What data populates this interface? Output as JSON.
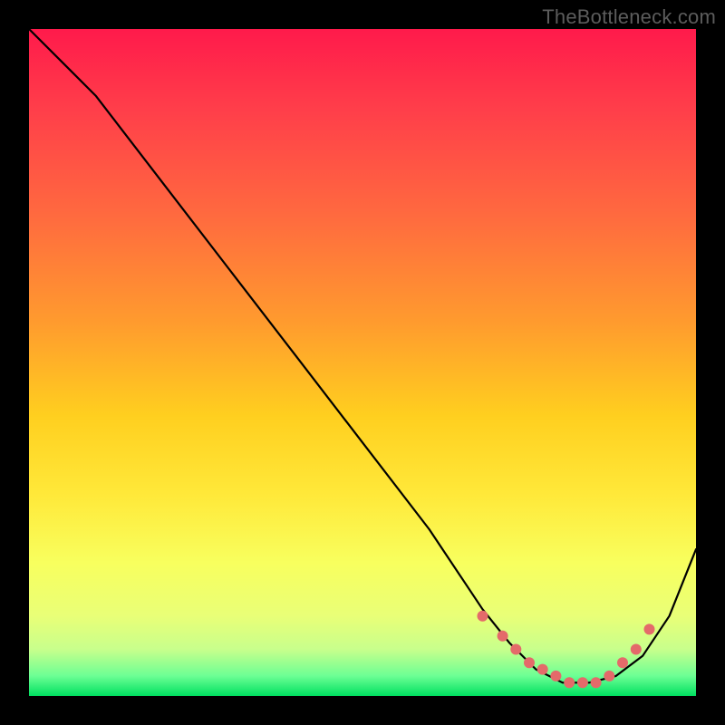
{
  "watermark": "TheBottleneck.com",
  "chart_data": {
    "type": "line",
    "title": "",
    "xlabel": "",
    "ylabel": "",
    "xlim": [
      0,
      100
    ],
    "ylim": [
      0,
      100
    ],
    "grid": false,
    "legend": false,
    "series": [
      {
        "name": "curve",
        "color": "#000000",
        "x": [
          0,
          6,
          10,
          20,
          30,
          40,
          50,
          60,
          68,
          72,
          76,
          80,
          84,
          88,
          92,
          96,
          100
        ],
        "y": [
          100,
          94,
          90,
          77,
          64,
          51,
          38,
          25,
          13,
          8,
          4,
          2,
          2,
          3,
          6,
          12,
          22
        ]
      }
    ],
    "markers": {
      "name": "dots",
      "color": "#e46a6a",
      "radius": 6,
      "x": [
        68,
        71,
        73,
        75,
        77,
        79,
        81,
        83,
        85,
        87,
        89,
        91,
        93
      ],
      "y": [
        12,
        9,
        7,
        5,
        4,
        3,
        2,
        2,
        2,
        3,
        5,
        7,
        10
      ]
    }
  }
}
